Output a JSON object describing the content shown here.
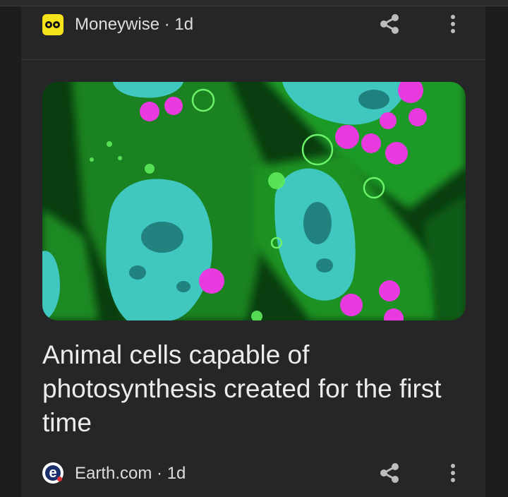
{
  "feed": {
    "top_item": {
      "source": "Moneywise",
      "age": "1d",
      "source_line": "Moneywise · 1d",
      "logo_icon": "moneywise-logo",
      "share_icon": "share-icon",
      "more_icon": "more-vert-icon"
    },
    "article": {
      "image_description": "fluorescence-microscopy-cells",
      "headline": "Animal cells capable of photosynthesis created for the first time",
      "source": "Earth.com",
      "age": "1d",
      "source_line": "Earth.com · 1d",
      "logo_icon": "earth-com-logo",
      "share_icon": "share-icon",
      "more_icon": "more-vert-icon"
    }
  },
  "colors": {
    "background": "#1d1d1f",
    "card": "#262628",
    "text": "#ececec",
    "moneywise_brand": "#f4e21b",
    "earth_brand": "#1c2f6d"
  }
}
